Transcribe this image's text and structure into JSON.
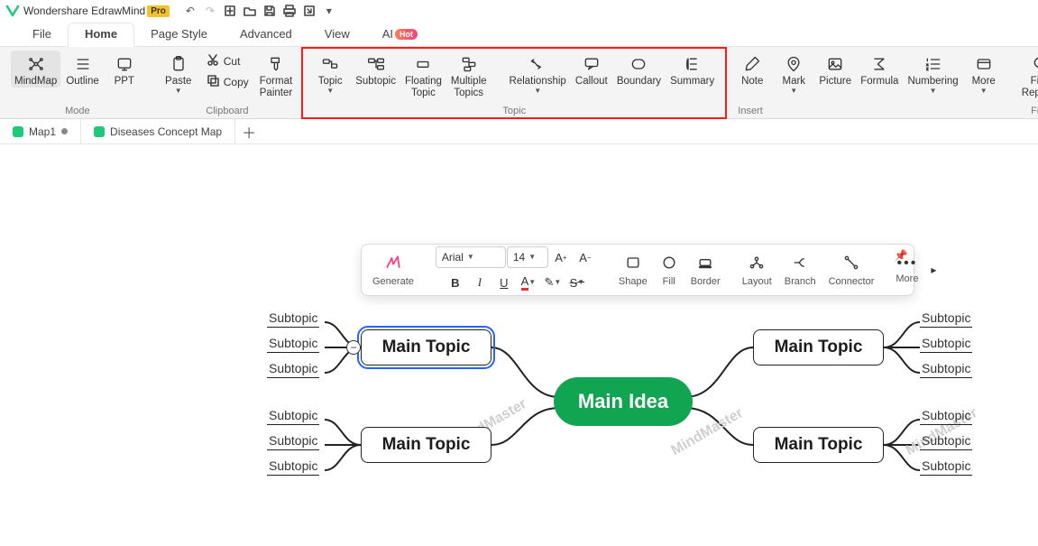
{
  "titlebar": {
    "app_name": "Wondershare EdrawMind",
    "pro_label": "Pro"
  },
  "qat": {
    "undo": "↶",
    "redo": "↷",
    "new": "＋",
    "open": "▭",
    "save": "💾",
    "print": "⎙",
    "export": "⇪"
  },
  "menu": {
    "file": "File",
    "home": "Home",
    "page_style": "Page Style",
    "advanced": "Advanced",
    "view": "View",
    "ai": "AI",
    "ai_badge": "Hot"
  },
  "ribbon": {
    "mode": {
      "mindmap": "MindMap",
      "outline": "Outline",
      "ppt": "PPT",
      "label": "Mode"
    },
    "clipboard": {
      "paste": "Paste",
      "cut": "Cut",
      "copy": "Copy",
      "format_painter": "Format\nPainter",
      "label": "Clipboard"
    },
    "topic_group": {
      "topic": "Topic",
      "subtopic": "Subtopic",
      "floating": "Floating\nTopic",
      "multiple": "Multiple\nTopics",
      "relationship": "Relationship",
      "callout": "Callout",
      "boundary": "Boundary",
      "summary": "Summary",
      "label": "Topic"
    },
    "insert": {
      "note": "Note",
      "mark": "Mark",
      "picture": "Picture",
      "formula": "Formula",
      "numbering": "Numbering",
      "more": "More",
      "label": "Insert"
    },
    "find": {
      "find_replace": "Find\nReplace",
      "label": "Find"
    }
  },
  "doctabs": {
    "tab1": "Map1",
    "tab2": "Diseases Concept Map"
  },
  "float": {
    "generate": "Generate",
    "font": "Arial",
    "size": "14",
    "a_plus": "A⁺",
    "a_minus": "A⁻",
    "bold": "B",
    "italic": "I",
    "underline": "U",
    "font_color": "A",
    "highlight": "✎",
    "strike": "S",
    "shape": "Shape",
    "fill": "Fill",
    "border": "Border",
    "layout": "Layout",
    "branch": "Branch",
    "connector": "Connector",
    "more": "More"
  },
  "nodes": {
    "central": "Main Idea",
    "mt1": "Main Topic",
    "mt2": "Main Topic",
    "mt3": "Main Topic",
    "mt4": "Main Topic",
    "s": "Subtopic"
  },
  "watermark": "MindMaster"
}
